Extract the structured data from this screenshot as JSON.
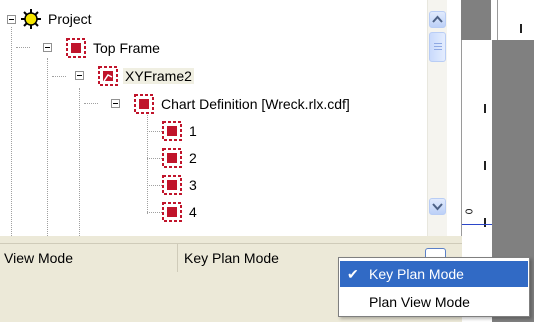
{
  "tree": {
    "nodes": [
      {
        "label": "Project",
        "icon": "sun-icon"
      },
      {
        "label": "Top Frame",
        "icon": "frame-icon"
      },
      {
        "label": "XYFrame2",
        "icon": "xyframe-icon",
        "selected": true
      },
      {
        "label": "Chart Definition [Wreck.rlx.cdf]",
        "icon": "frame-icon"
      },
      {
        "label": "1",
        "icon": "frame-icon"
      },
      {
        "label": "2",
        "icon": "frame-icon"
      },
      {
        "label": "3",
        "icon": "frame-icon"
      },
      {
        "label": "4",
        "icon": "frame-icon"
      }
    ]
  },
  "ruler": {
    "tick_label": "0"
  },
  "property": {
    "name": "View Mode",
    "value": "Key Plan Mode"
  },
  "dropdown": {
    "options": [
      {
        "label": "Key Plan Mode",
        "selected": true,
        "check": "✔"
      },
      {
        "label": "Plan View Mode",
        "selected": false
      }
    ]
  },
  "colors": {
    "selection": "#316ac5",
    "panel": "#ece9d8",
    "frame_red": "#c0142b"
  }
}
